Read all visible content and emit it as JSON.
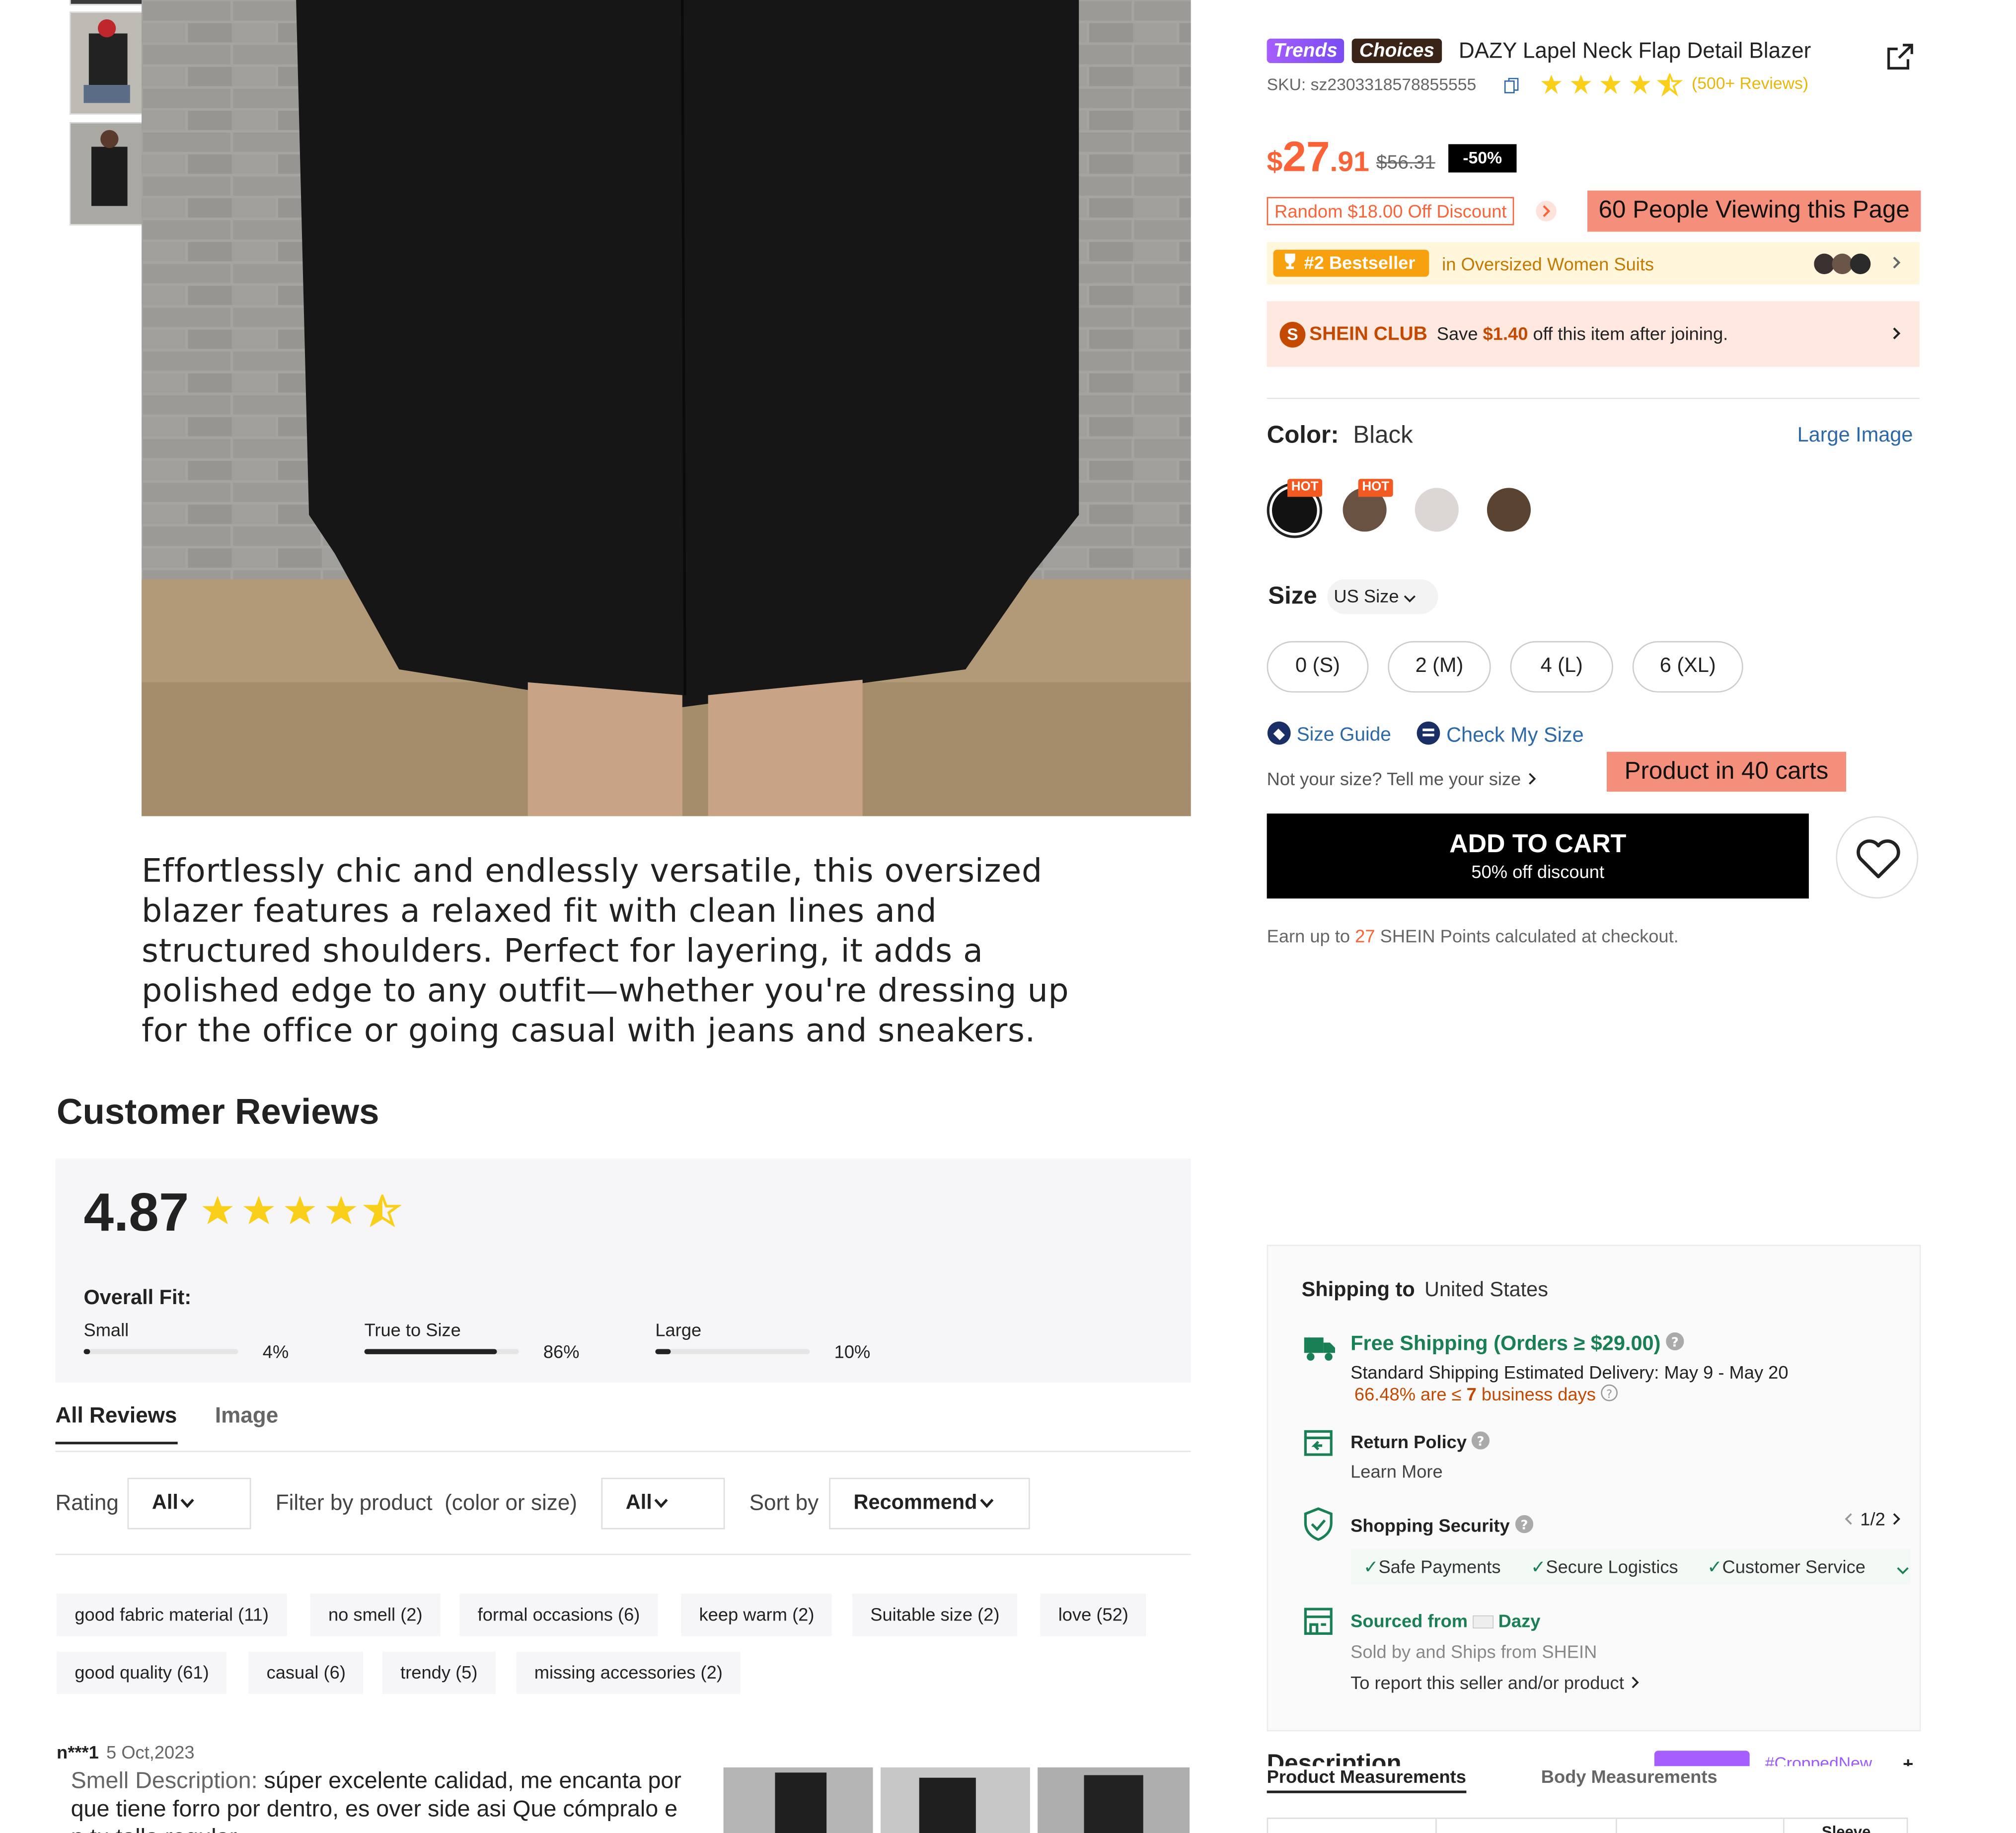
{
  "product": {
    "trend_badge": "Trends",
    "choices_badge": "Choices",
    "title": "DAZY Lapel Neck Flap Detail Blazer",
    "sku": "SKU: sz2303318578855555",
    "reviews_link": "(500+ Reviews)",
    "price_currency": "$",
    "price_int": "27",
    "price_dec": ".91",
    "price_original": "$56.31",
    "discount_badge": "-50%",
    "coupon_text": "Random $18.00 Off Discount",
    "viewers_text": "60 People Viewing this Page",
    "bestseller_badge": "#2 Bestseller",
    "bestseller_category": "in Oversized Women Suits",
    "club_label": "SHEIN CLUB",
    "club_save_prefix": "Save",
    "club_save_amount": "$1.40",
    "club_save_suffix": "off this item after joining.",
    "color_label": "Color:",
    "color_value": "Black",
    "large_image_link": "Large Image",
    "hot_label": "HOT",
    "size_label": "Size",
    "size_unit_select": "US Size",
    "sizes": [
      "0 (S)",
      "2 (M)",
      "4 (L)",
      "6 (XL)"
    ],
    "size_guide": "Size Guide",
    "check_size": "Check My Size",
    "not_your_size": "Not your size? Tell me your size",
    "carts_text": "Product in 40 carts",
    "add_to_cart": "ADD TO CART",
    "add_to_cart_sub": "50% off discount",
    "points_prefix": "Earn up to",
    "points_value": "27",
    "points_suffix": "SHEIN Points calculated at checkout.",
    "colors": {
      "accent": "#fa6338",
      "black": "#000000",
      "rating": "#facf19",
      "link": "#2d68a8",
      "green": "#198055",
      "club": "#c44a01"
    }
  },
  "description": "Effortlessly chic and endlessly versatile, this oversized blazer features a relaxed fit with clean lines and structured shoulders. Perfect for layering, it adds a polished edge to any outfit—whether you're dressing up for the office or going casual with jeans and sneakers.",
  "reviews": {
    "title": "Customer Reviews",
    "rating": "4.87",
    "overall_fit_label": "Overall Fit:",
    "fit": [
      {
        "label": "Small",
        "percent": "4%",
        "value": 0.04
      },
      {
        "label": "True to Size",
        "percent": "86%",
        "value": 0.86
      },
      {
        "label": "Large",
        "percent": "10%",
        "value": 0.1
      }
    ],
    "tabs": [
      "All Reviews",
      "Image"
    ],
    "rating_filter_label": "Rating",
    "rating_filter_value": "All",
    "product_filter_label": "Filter by product  (color or size)",
    "product_filter_value": "All",
    "sort_label": "Sort by",
    "sort_value": "Recommend",
    "tags": [
      "good fabric material (11)",
      "no smell (2)",
      "formal occasions (6)",
      "keep warm (2)",
      "Suitable size (2)",
      "love (52)",
      "good quality (61)",
      "casual (6)",
      "trendy (5)",
      "missing accessories (2)"
    ],
    "first_review": {
      "user": "n***1",
      "date": "5 Oct,2023",
      "text_label": "Smell Description:",
      "text_line1": "súper excelente calidad, me encanta por",
      "text_line2": "que tiene forro por dentro, es over side asi Que cómpralo e",
      "text_line3": "n tu talla regular"
    }
  },
  "shipping": {
    "label": "Shipping to",
    "country": "United States",
    "free_title": "Free Shipping (Orders ≥ $29.00)",
    "standard": "Standard Shipping Estimated Delivery: May 9 - May 20",
    "on_time_pct": "66.48% are ≤",
    "on_time_days": "7",
    "on_time_unit": "business days",
    "return_title": "Return Policy",
    "return_link": "Learn More",
    "security_title": "Shopping Security",
    "security_pager": "1/2",
    "security_items": [
      "Safe Payments",
      "Secure Logistics",
      "Customer Service"
    ],
    "sourced_title": "Sourced from",
    "sourced_brand": "Dazy",
    "sold_by": "Sold by and Ships from SHEIN",
    "report": "To report this seller and/or product"
  },
  "bottom_tabs": {
    "description": "Description",
    "product_measurements": "Product Measurements",
    "body_measurements": "Body Measurements",
    "trend_tag": "#CroppedNew",
    "sleeve": "Sleeve"
  }
}
